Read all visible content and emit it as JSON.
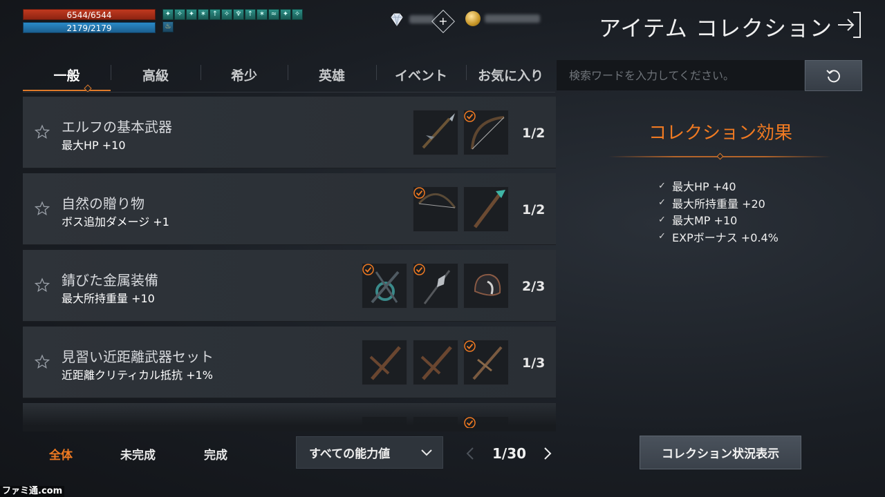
{
  "player": {
    "hp": "6544/6544",
    "mp": "2179/2179"
  },
  "title": "アイテム コレクション",
  "tabs": [
    {
      "label": "一般",
      "active": true
    },
    {
      "label": "高級"
    },
    {
      "label": "希少"
    },
    {
      "label": "英雄"
    },
    {
      "label": "イベント"
    },
    {
      "label": "お気に入り"
    }
  ],
  "search": {
    "placeholder": "検索ワードを入力してください。"
  },
  "collections": [
    {
      "name": "エルフの基本武器",
      "effect": "最大HP +10",
      "progress": "1/2",
      "items": [
        {
          "icon": "spear-icon",
          "owned": false
        },
        {
          "icon": "bow-icon",
          "owned": true
        }
      ]
    },
    {
      "name": "自然の贈り物",
      "effect": "ボス追加ダメージ +1",
      "progress": "1/2",
      "items": [
        {
          "icon": "bow-icon",
          "owned": true
        },
        {
          "icon": "dagger-icon",
          "owned": false
        }
      ]
    },
    {
      "name": "錆びた金属装備",
      "effect": "最大所持重量 +10",
      "progress": "2/3",
      "items": [
        {
          "icon": "crossbow-icon",
          "owned": true
        },
        {
          "icon": "spear-icon",
          "owned": true
        },
        {
          "icon": "helmet-icon",
          "owned": false
        }
      ]
    },
    {
      "name": "見習い近距離武器セット",
      "effect": "近距離クリティカル抵抗 +1%",
      "progress": "1/3",
      "items": [
        {
          "icon": "sword-icon",
          "owned": false
        },
        {
          "icon": "sword-icon",
          "owned": false
        },
        {
          "icon": "sword-icon",
          "owned": true
        }
      ]
    }
  ],
  "effects_panel": {
    "title": "コレクション効果",
    "effects": [
      "最大HP +40",
      "最大所持重量 +20",
      "最大MP +10",
      "EXPボーナス +0.4%"
    ]
  },
  "filters": {
    "all": "全体",
    "incomplete": "未完成",
    "complete": "完成"
  },
  "stat_dropdown": {
    "selected": "すべての能力値"
  },
  "pagination": {
    "current": "1/30"
  },
  "status_button": "コレクション状況表示",
  "watermark": "ファミ通.com",
  "colors": {
    "accent": "#f07a22",
    "hp": "#c0391f",
    "mp": "#2a8ac8"
  }
}
